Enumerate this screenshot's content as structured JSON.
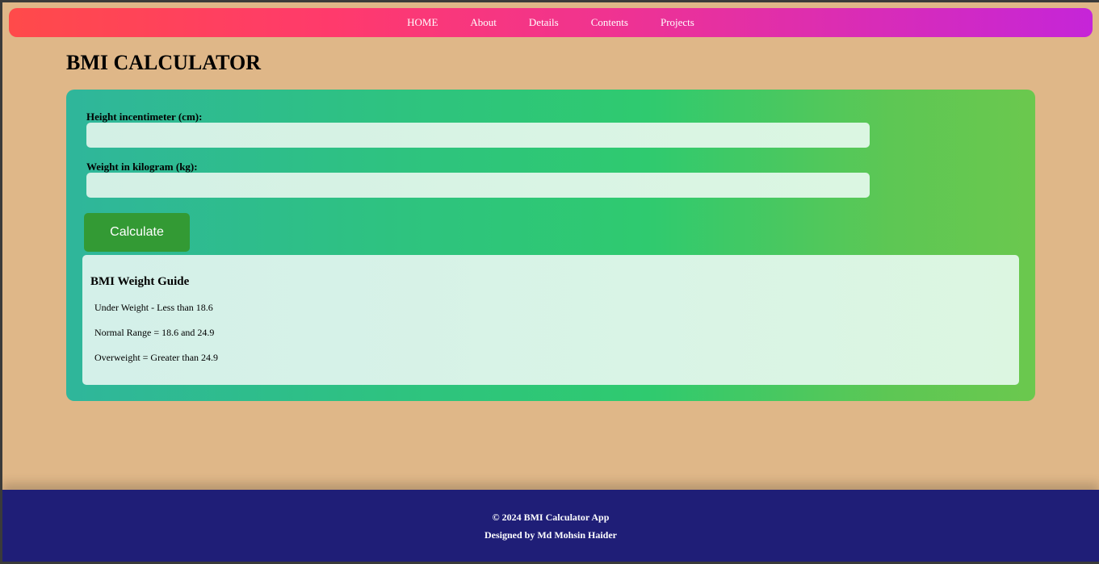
{
  "nav": {
    "items": [
      {
        "label": "HOME"
      },
      {
        "label": "About"
      },
      {
        "label": "Details"
      },
      {
        "label": "Contents"
      },
      {
        "label": "Projects"
      }
    ]
  },
  "page": {
    "title": "BMI CALCULATOR"
  },
  "form": {
    "height_label": "Height incentimeter (cm):",
    "height_value": "",
    "weight_label": "Weight in kilogram (kg):",
    "weight_value": "",
    "calculate_label": "Calculate"
  },
  "guide": {
    "title": "BMI Weight Guide",
    "lines": [
      "Under Weight - Less than 18.6",
      "Normal Range = 18.6 and 24.9",
      "Overweight = Greater than 24.9"
    ]
  },
  "footer": {
    "copyright": "© 2024 BMI Calculator App",
    "credit": "Designed by Md Mohsin Haider"
  },
  "colors": {
    "page_background": "#dfb788",
    "button": "#339a34",
    "footer": "#1f1e77"
  }
}
